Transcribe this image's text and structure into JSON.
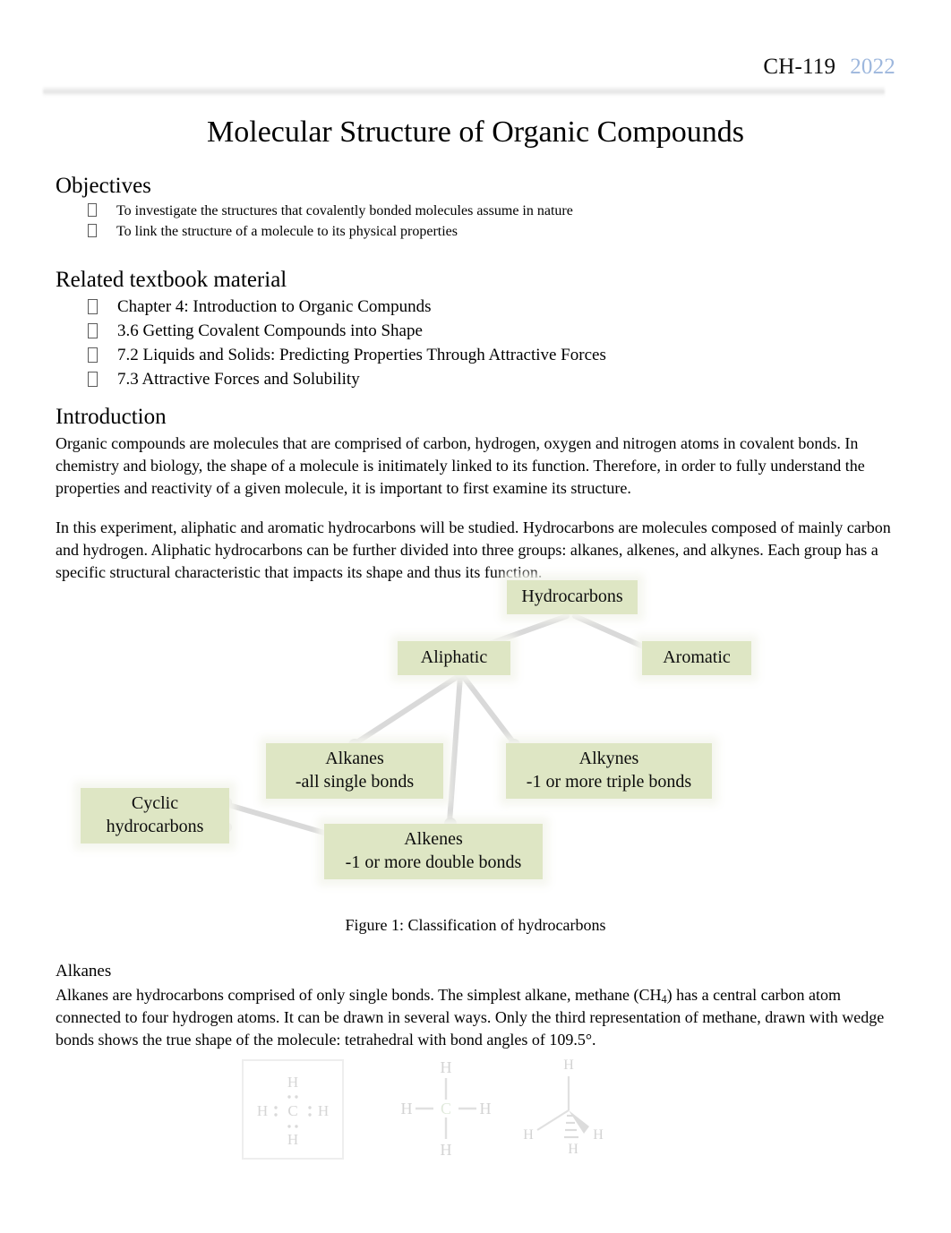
{
  "header": {
    "course": "CH-119",
    "year": "2022"
  },
  "title": "Molecular Structure of Organic Compounds",
  "sections": {
    "objectives": {
      "heading": "Objectives",
      "items": [
        "To investigate the structures that covalently bonded molecules assume in nature",
        "To link the structure of a molecule to its physical properties"
      ]
    },
    "textbook": {
      "heading": "Related textbook material",
      "items": [
        "Chapter 4: Introduction to Organic Compunds",
        "3.6 Getting Covalent Compounds into Shape",
        "7.2 Liquids and Solids: Predicting Properties Through Attractive Forces",
        "7.3 Attractive Forces and Solubility"
      ]
    },
    "introduction": {
      "heading": "Introduction",
      "paragraph1": "Organic compounds are molecules that are comprised of carbon, hydrogen, oxygen and nitrogen atoms in covalent bonds. In chemistry and biology, the shape of a molecule is initimately linked to its function.   Therefore, in order to fully understand the properties and reactivity of a given molecule, it is important to first examine its structure.",
      "paragraph2": "In this experiment, aliphatic  and aromatic  hydrocarbons will be studied.  Hydrocarbons are molecules composed of mainly carbon and hydrogen.  Aliphatic hydrocarbons can be further divided into three groups:   alkanes, alkenes, and alkynes.  Each group has a specific structural characteristic that impacts its shape and thus its function."
    },
    "alkanes": {
      "heading": "Alkanes",
      "paragraph_part1": "Alkanes are hydrocarbons comprised of only single bonds.  The simplest alkane, methane (CH",
      "paragraph_sub": "4",
      "paragraph_part2": ") has a central carbon atom connected to four hydrogen atoms.    It can be drawn in several ways.  Only the third representation of methane, drawn with wedge bonds shows the true shape of the molecule: tetrahedral with bond angles of 109.5°."
    }
  },
  "figure": {
    "caption": "Figure 1: Classification of hydrocarbons",
    "node_fill": "#dee6c4",
    "nodes": [
      {
        "id": "hydrocarbons",
        "label": "Hydrocarbons"
      },
      {
        "id": "aliphatic",
        "label": "Aliphatic"
      },
      {
        "id": "aromatic",
        "label": "Aromatic"
      },
      {
        "id": "alkanes",
        "label": "Alkanes\n-all single bonds"
      },
      {
        "id": "alkynes",
        "label": "Alkynes\n-1 or more triple bonds"
      },
      {
        "id": "alkenes",
        "label": "Alkenes\n-1 or more double  bonds"
      },
      {
        "id": "cyclic",
        "label": "Cyclic\nhydrocarbons"
      }
    ],
    "edges": [
      {
        "from": "hydrocarbons",
        "to": "aliphatic"
      },
      {
        "from": "hydrocarbons",
        "to": "aromatic"
      },
      {
        "from": "aliphatic",
        "to": "alkanes"
      },
      {
        "from": "aliphatic",
        "to": "alkenes"
      },
      {
        "from": "aliphatic",
        "to": "alkynes"
      },
      {
        "from": "alkenes",
        "to": "cyclic"
      }
    ]
  },
  "molecule_figures": [
    {
      "id": "methane-lewis-boxed",
      "label": "methane Lewis structure in box"
    },
    {
      "id": "methane-structural",
      "label": "methane structural formula"
    },
    {
      "id": "methane-wedge-tetrahedral",
      "label": "methane wedge-dash tetrahedral"
    }
  ]
}
